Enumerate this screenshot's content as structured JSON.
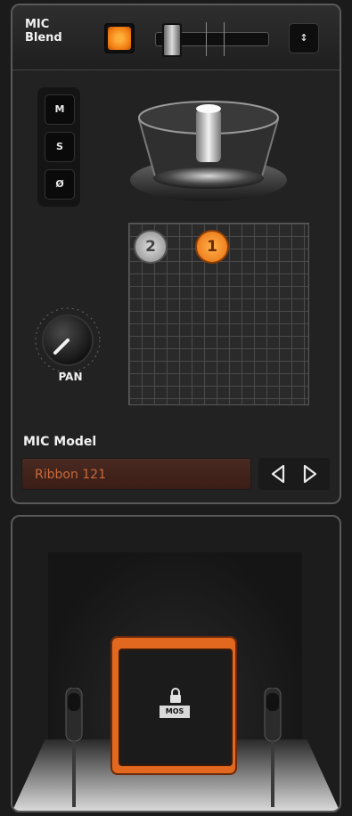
{
  "header": {
    "mic_blend_label": "MIC\nBlend",
    "right_button_label": "↕"
  },
  "msp_buttons": [
    {
      "label": "M"
    },
    {
      "label": "S"
    },
    {
      "label": "Ø"
    }
  ],
  "mic_positions": [
    {
      "label": "2",
      "color": "#b9b9b9"
    },
    {
      "label": "1",
      "color": "#f28a1f"
    }
  ],
  "pan": {
    "label": "PAN"
  },
  "mic_model": {
    "label": "MIC Model",
    "value": "Ribbon 121"
  },
  "amp": {
    "badge_label": "MOS"
  },
  "colors": {
    "accent_orange": "#f28a1f",
    "panel_bg": "#222222",
    "model_field_bg": "#3a1d16"
  }
}
